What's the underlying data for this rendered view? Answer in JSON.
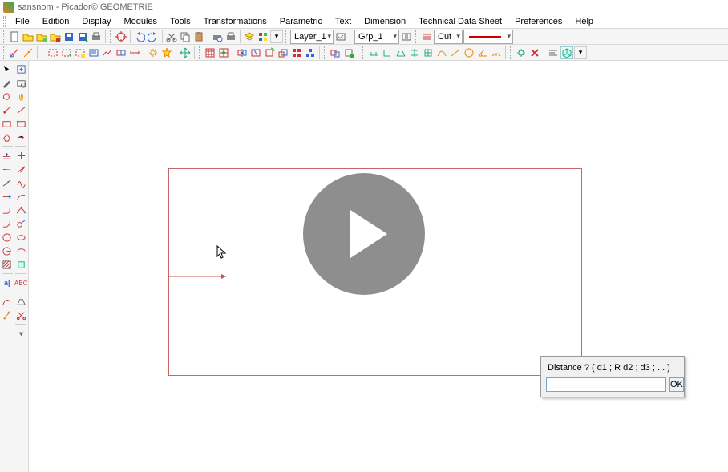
{
  "app": {
    "icon": "app-icon",
    "title": "sansnom - Picador© GEOMETRIE"
  },
  "menu": {
    "items": [
      "File",
      "Edition",
      "Display",
      "Modules",
      "Tools",
      "Transformations",
      "Parametric",
      "Text",
      "Dimension",
      "Technical Data Sheet",
      "Preferences",
      "Help"
    ]
  },
  "toolbar1": {
    "layer_label": "Layer_1",
    "group_label": "Grp_1",
    "cut_label": "Cut"
  },
  "dialog": {
    "label": "Distance ? ( d1 ; R d2 ; d3 ; ... )",
    "value": "",
    "placeholder": "",
    "ok": "OK"
  },
  "canvas": {
    "cursor_name": "arrow-cursor"
  },
  "video": {
    "play_label": "play"
  }
}
